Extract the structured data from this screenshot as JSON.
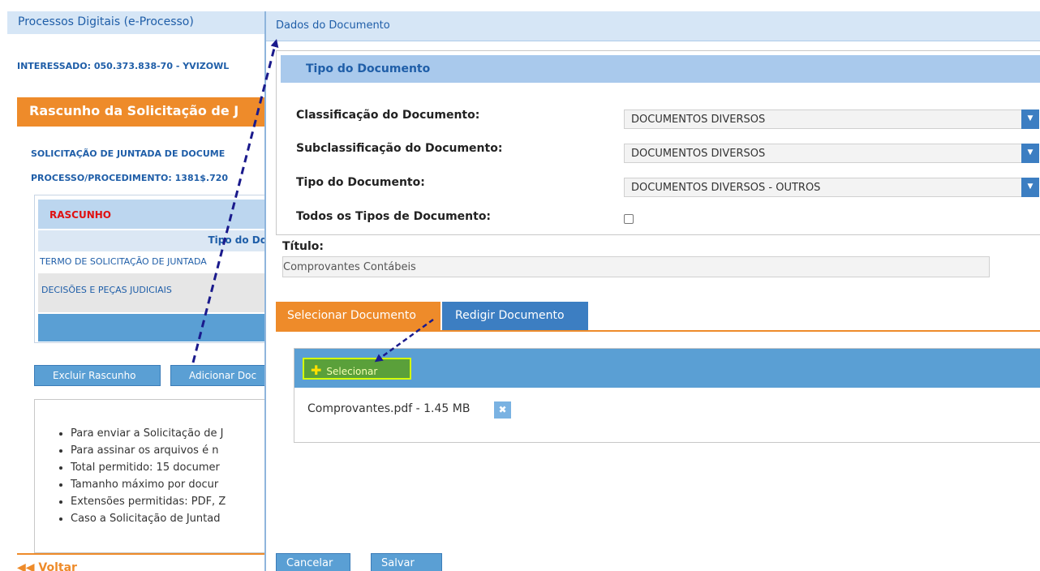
{
  "background": {
    "window_title": "Processos Digitais (e-Processo)",
    "interessado": "INTERESSADO: 050.373.838-70 - YVIZOWL",
    "section_title": "Rascunho da Solicitação de J",
    "solicitacao": "SOLICITAÇÃO DE JUNTADA DE DOCUME",
    "processo": "PROCESSO/PROCEDIMENTO: 1381$.720",
    "table": {
      "status": "RASCUNHO",
      "column_header": "Tipo do Do",
      "rows": [
        "TERMO DE SOLICITAÇÃO DE JUNTADA",
        "DECISÕES E PEÇAS JUDICIAIS"
      ]
    },
    "buttons": {
      "excluir": "Excluir Rascunho",
      "adicionar": "Adicionar Doc"
    },
    "info_items": [
      "Para enviar a Solicitação de J",
      "Para assinar os arquivos é n",
      "Total permitido: 15 documer",
      "Tamanho máximo por docur",
      "Extensões permitidas: PDF, Z",
      "Caso a Solicitação de Juntad"
    ],
    "voltar": "◀◀ Voltar"
  },
  "modal": {
    "title": "Dados do Documento",
    "tipo_section": "Tipo do Documento",
    "fields": {
      "classificacao": {
        "label": "Classificação do Documento:",
        "value": "DOCUMENTOS DIVERSOS"
      },
      "subclassificacao": {
        "label": "Subclassificação do Documento:",
        "value": "DOCUMENTOS DIVERSOS"
      },
      "tipo": {
        "label": "Tipo do Documento:",
        "value": "DOCUMENTOS DIVERSOS - OUTROS"
      },
      "todos": {
        "label": "Todos os Tipos de Documento:",
        "checked": false
      }
    },
    "titulo": {
      "label": "Título:",
      "value": "Comprovantes Contábeis"
    },
    "tabs": [
      "Selecionar Documento",
      "Redigir Documento"
    ],
    "selecionar_button": "Selecionar",
    "file": {
      "name": "Comprovantes.pdf - 1.45 MB",
      "delete_icon": "close-icon"
    },
    "cancelar": "Cancelar",
    "salvar": "Salvar"
  },
  "colors": {
    "orange": "#ee8b2a",
    "blue": "#3c7ec2",
    "light_blue": "#d6e6f6",
    "arrow": "#1a1a8c",
    "highlight": "#d4ff00"
  }
}
